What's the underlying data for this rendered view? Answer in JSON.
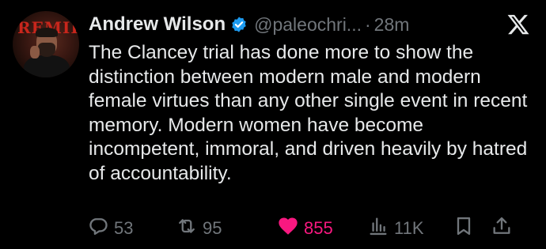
{
  "author": {
    "name": "Andrew Wilson",
    "handle": "@paleochri...",
    "separator": "·",
    "time": "28m",
    "avatar_banner_text": "REMIB"
  },
  "tweet": {
    "text": "The Clancey trial has done more to show the distinction between modern male and modern female virtues than any other single event in recent memory. Modern women have become incompetent, immoral, and driven heavily by hatred of accountability."
  },
  "actions": {
    "replies": "53",
    "retweets": "95",
    "likes": "855",
    "views": "11K"
  },
  "icons": {
    "verified": "verified-badge-icon",
    "platform": "x-logo-icon",
    "reply": "reply-bubble-icon",
    "retweet": "retweet-icon",
    "like": "heart-icon",
    "views": "views-bars-icon",
    "bookmark": "bookmark-icon",
    "share": "share-icon"
  },
  "colors": {
    "background": "#000000",
    "text": "#e7e9ea",
    "muted": "#71767b",
    "like_active": "#f91880",
    "verified": "#1d9bf0"
  }
}
